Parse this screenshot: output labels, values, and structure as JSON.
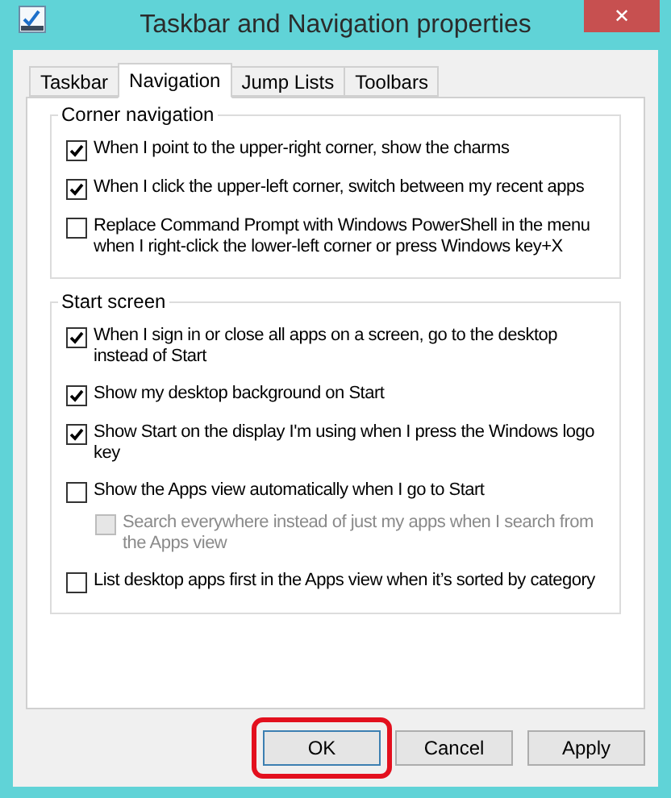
{
  "window": {
    "title": "Taskbar and Navigation properties",
    "close": "✕"
  },
  "tabs": [
    {
      "label": "Taskbar",
      "selected": false
    },
    {
      "label": "Navigation",
      "selected": true
    },
    {
      "label": "Jump Lists",
      "selected": false
    },
    {
      "label": "Toolbars",
      "selected": false
    }
  ],
  "groups": [
    {
      "title": "Corner navigation",
      "items": [
        {
          "label": "When I point to the upper-right corner, show the charms",
          "checked": true,
          "disabled": false
        },
        {
          "label": "When I click the upper-left corner, switch between my recent apps",
          "checked": true,
          "disabled": false
        },
        {
          "label": "Replace Command Prompt with Windows PowerShell in the menu when I right-click the lower-left corner or press Windows key+X",
          "checked": false,
          "disabled": false
        }
      ]
    },
    {
      "title": "Start screen",
      "items": [
        {
          "label": "When I sign in or close all apps on a screen, go to the desktop instead of Start",
          "checked": true,
          "disabled": false
        },
        {
          "label": "Show my desktop background on Start",
          "checked": true,
          "disabled": false
        },
        {
          "label": "Show Start on the display I'm using when I press the Windows logo key",
          "checked": true,
          "disabled": false
        },
        {
          "label": "Show the Apps view automatically when I go to Start",
          "checked": false,
          "disabled": false,
          "children": [
            {
              "label": "Search everywhere instead of just my apps when I search from the Apps view",
              "checked": false,
              "disabled": true
            }
          ]
        },
        {
          "label": "List desktop apps first in the Apps view when it’s sorted by category",
          "checked": false,
          "disabled": false
        }
      ]
    }
  ],
  "buttons": [
    {
      "label": "OK",
      "highlighted": true
    },
    {
      "label": "Cancel",
      "highlighted": false
    },
    {
      "label": "Apply",
      "highlighted": false
    }
  ]
}
